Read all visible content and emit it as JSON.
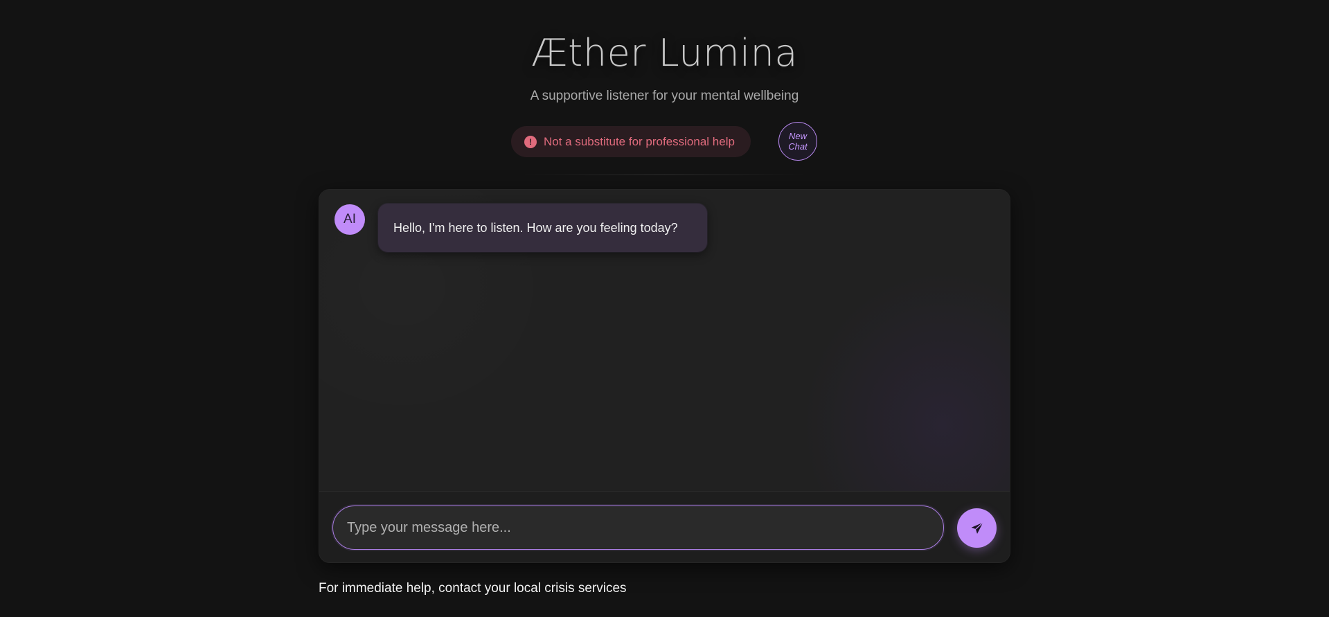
{
  "header": {
    "title": "Æther Lumina",
    "subtitle": "A supportive listener for your mental wellbeing"
  },
  "disclaimer": {
    "icon": "exclamation-circle-icon",
    "text": "Not a substitute for professional help"
  },
  "new_chat": {
    "line1": "New",
    "line2": "Chat"
  },
  "chat": {
    "messages": [
      {
        "sender": "AI",
        "avatar_label": "AI",
        "text": "Hello, I'm here to listen. How are you feeling today?"
      }
    ],
    "input": {
      "value": "",
      "placeholder": "Type your message here..."
    },
    "send_icon": "paper-plane-icon"
  },
  "footer": {
    "note": "For immediate help, contact your local crisis services"
  },
  "colors": {
    "accent": "#c08cf9",
    "warning": "#e06b7d",
    "background": "#131313"
  }
}
